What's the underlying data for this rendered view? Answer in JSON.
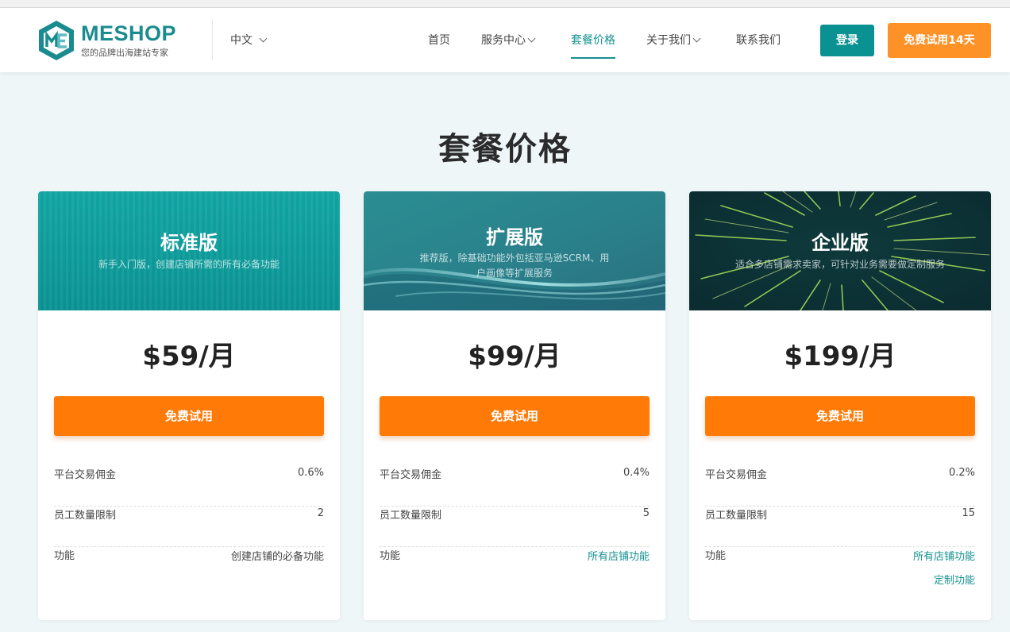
{
  "brand": {
    "name": "MESHOP",
    "slogan": "您的品牌出海建站专家",
    "accent_color": "#14928f",
    "cta_color": "#ff7a06"
  },
  "header": {
    "language": "中文",
    "nav": [
      {
        "label": "首页",
        "active": false
      },
      {
        "label": "服务中心",
        "active": false
      },
      {
        "label": "套餐价格",
        "active": true
      },
      {
        "label": "关于我们",
        "active": false
      },
      {
        "label": "联系我们",
        "active": false
      }
    ],
    "login_label": "登录",
    "trial_label": "免费试用14天"
  },
  "main": {
    "title": "套餐价格",
    "plans": [
      {
        "name": "标准版",
        "description": "新手入门版，创建店铺所需的所有必备功能",
        "price": "$59/月",
        "cta": "免费试用",
        "features": [
          {
            "label": "平台交易佣金",
            "value": "0.6%"
          },
          {
            "label": "员工数量限制",
            "value": "2"
          },
          {
            "label": "功能",
            "value": "创建店铺的必备功能"
          }
        ]
      },
      {
        "name": "扩展版",
        "description": "推荐版，除基础功能外包括亚马逊SCRM、用户画像等扩展服务",
        "price": "$99/月",
        "cta": "免费试用",
        "features": [
          {
            "label": "平台交易佣金",
            "value": "0.4%"
          },
          {
            "label": "员工数量限制",
            "value": "5"
          },
          {
            "label": "功能",
            "value": "所有店铺功能"
          }
        ]
      },
      {
        "name": "企业版",
        "description": "适合多店铺需求卖家，可针对业务需要做定制服务",
        "price": "$199/月",
        "cta": "免费试用",
        "features": [
          {
            "label": "平台交易佣金",
            "value": "0.2%"
          },
          {
            "label": "员工数量限制",
            "value": "15"
          },
          {
            "label": "功能",
            "value": "所有店铺功能",
            "value2": "定制功能"
          }
        ]
      }
    ]
  }
}
